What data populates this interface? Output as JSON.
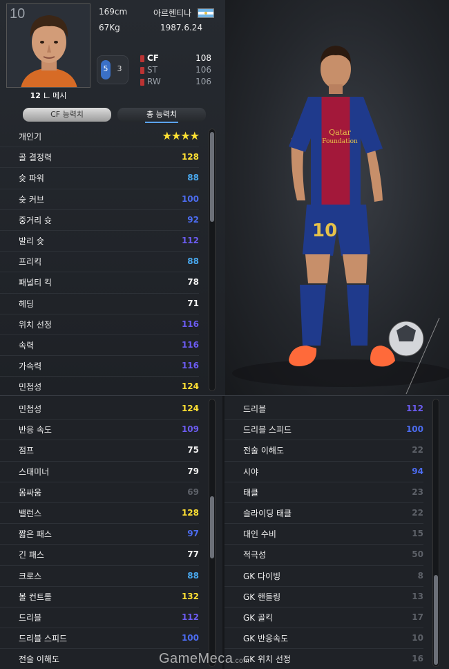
{
  "player": {
    "overall": "10",
    "number": "12",
    "name": "L. 메시",
    "height": "169cm",
    "weight": "67Kg",
    "nation": "아르헨티나",
    "birth": "1987.6.24",
    "weak_foot_left": "5",
    "weak_foot_right": "3"
  },
  "positions": [
    {
      "name": "CF",
      "value": "108"
    },
    {
      "name": "ST",
      "value": "106"
    },
    {
      "name": "RW",
      "value": "106"
    }
  ],
  "tabs": {
    "cf_label": "CF 능력치",
    "total_label": "총 능력치"
  },
  "list1": [
    {
      "label": "개인기",
      "stars": "★★★★"
    },
    {
      "label": "골 결정력",
      "value": "128",
      "color": "yellow"
    },
    {
      "label": "슛 파워",
      "value": "88",
      "color": "cyan"
    },
    {
      "label": "슛 커브",
      "value": "100",
      "color": "blue"
    },
    {
      "label": "중거리 슛",
      "value": "92",
      "color": "blue"
    },
    {
      "label": "발리 슛",
      "value": "112",
      "color": "purple"
    },
    {
      "label": "프리킥",
      "value": "88",
      "color": "cyan"
    },
    {
      "label": "패널티 킥",
      "value": "78",
      "color": "white"
    },
    {
      "label": "헤딩",
      "value": "71",
      "color": "white"
    },
    {
      "label": "위치 선정",
      "value": "116",
      "color": "purple"
    },
    {
      "label": "속력",
      "value": "116",
      "color": "purple"
    },
    {
      "label": "가속력",
      "value": "116",
      "color": "purple"
    },
    {
      "label": "민첩성",
      "value": "124",
      "color": "yellow"
    }
  ],
  "list2": [
    {
      "label": "민첩성",
      "value": "124",
      "color": "yellow"
    },
    {
      "label": "반응 속도",
      "value": "109",
      "color": "purple"
    },
    {
      "label": "점프",
      "value": "75",
      "color": "white"
    },
    {
      "label": "스태미너",
      "value": "79",
      "color": "white"
    },
    {
      "label": "몸싸움",
      "value": "69",
      "color": "gray"
    },
    {
      "label": "밸런스",
      "value": "128",
      "color": "yellow"
    },
    {
      "label": "짧은 패스",
      "value": "97",
      "color": "blue"
    },
    {
      "label": "긴 패스",
      "value": "77",
      "color": "white"
    },
    {
      "label": "크로스",
      "value": "88",
      "color": "cyan"
    },
    {
      "label": "볼 컨트롤",
      "value": "132",
      "color": "yellow"
    },
    {
      "label": "드리블",
      "value": "112",
      "color": "purple"
    },
    {
      "label": "드리블 스피드",
      "value": "100",
      "color": "blue"
    },
    {
      "label": "전술 이해도",
      "value": "",
      "color": "gray"
    }
  ],
  "list3": [
    {
      "label": "드리블",
      "value": "112",
      "color": "purple"
    },
    {
      "label": "드리블 스피드",
      "value": "100",
      "color": "blue"
    },
    {
      "label": "전술 이해도",
      "value": "22",
      "color": "gray"
    },
    {
      "label": "시야",
      "value": "94",
      "color": "blue"
    },
    {
      "label": "태클",
      "value": "23",
      "color": "gray"
    },
    {
      "label": "슬라이딩 태클",
      "value": "22",
      "color": "gray"
    },
    {
      "label": "대인 수비",
      "value": "15",
      "color": "gray"
    },
    {
      "label": "적극성",
      "value": "50",
      "color": "gray"
    },
    {
      "label": "GK 다이빙",
      "value": "8",
      "color": "gray"
    },
    {
      "label": "GK 핸들링",
      "value": "13",
      "color": "gray"
    },
    {
      "label": "GK 골킥",
      "value": "17",
      "color": "gray"
    },
    {
      "label": "GK 반응속도",
      "value": "10",
      "color": "gray"
    },
    {
      "label": "GK 위치 선정",
      "value": "16",
      "color": "gray"
    }
  ],
  "watermark": {
    "main": "GameMeca",
    "suffix": ".com"
  },
  "colors": {
    "yellow": "#ffe033",
    "cyan": "#49a8ee",
    "blue": "#4c6cf0",
    "purple": "#6c5cf2",
    "white": "#f4f4f4",
    "gray": "#5d6168",
    "kit_blue": "#1f3a8c",
    "kit_red": "#a3183a"
  },
  "kit": {
    "number": "10",
    "sponsor_line1": "Qatar",
    "sponsor_line2": "Foundation"
  }
}
